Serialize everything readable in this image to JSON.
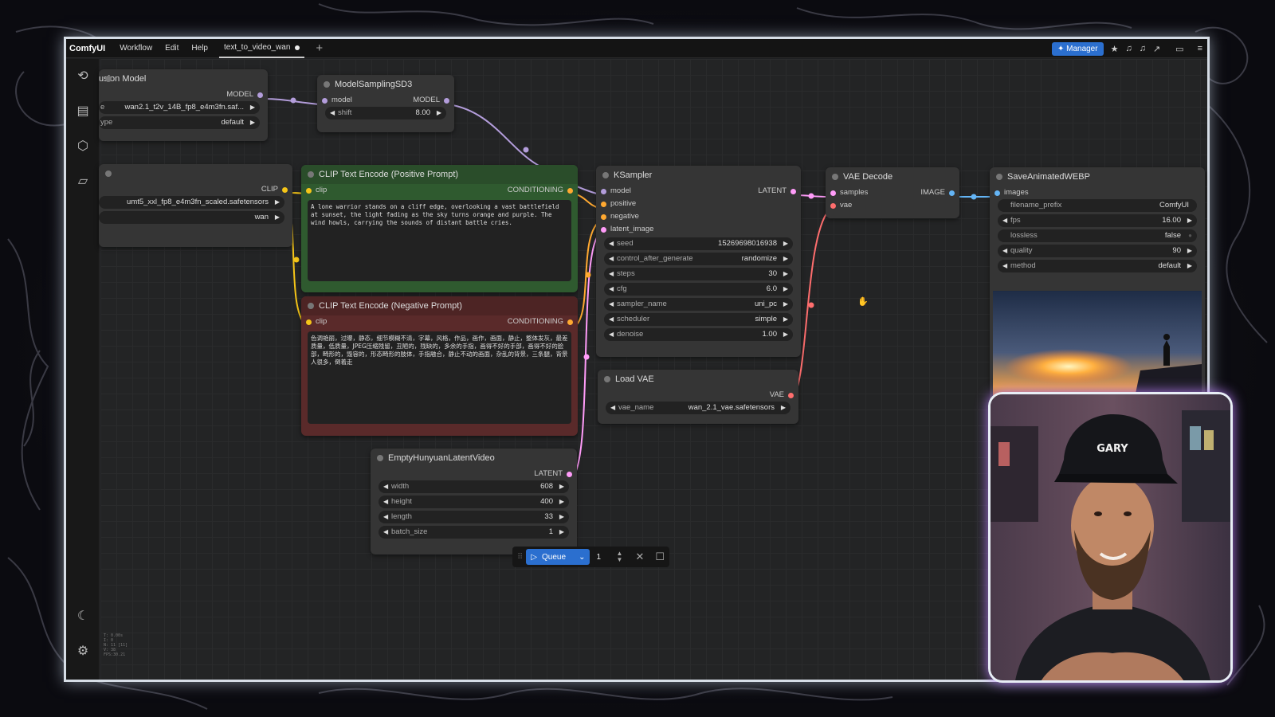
{
  "app": {
    "logo": "ComfyUI",
    "menus": [
      "Workflow",
      "Edit",
      "Help"
    ],
    "tab_name": "text_to_video_wan",
    "manager_label": "Manager"
  },
  "nodes": {
    "diffusion_model": {
      "title": "usion Model",
      "output": "MODEL",
      "widgets": [
        {
          "label": "e",
          "value": "wan2.1_t2v_14B_fp8_e4m3fn.saf..."
        },
        {
          "label": "ype",
          "value": "default"
        }
      ]
    },
    "model_sampling": {
      "title": "ModelSamplingSD3",
      "input": "model",
      "output": "MODEL",
      "widget": {
        "label": "shift",
        "value": "8.00"
      }
    },
    "clip_loader": {
      "output": "CLIP",
      "widgets": [
        {
          "label": "",
          "value": "umt5_xxl_fp8_e4m3fn_scaled.safetensors"
        },
        {
          "label": "",
          "value": "wan"
        }
      ]
    },
    "clip_positive": {
      "title": "CLIP Text Encode (Positive Prompt)",
      "input": "clip",
      "output": "CONDITIONING",
      "text": "A lone warrior stands on a cliff edge, overlooking a vast battlefield at sunset, the light fading as the sky turns orange and purple. The wind howls, carrying the sounds of distant battle cries."
    },
    "clip_negative": {
      "title": "CLIP Text Encode (Negative Prompt)",
      "input": "clip",
      "output": "CONDITIONING",
      "text": "色调艳丽，过曝，静态，细节模糊不清，字幕，风格，作品，画作，画面，静止，整体发灰，最差质量，低质量，JPEG压缩残留，丑陋的，残缺的，多余的手指，画得不好的手部，画得不好的脸部，畸形的，毁容的，形态畸形的肢体，手指融合，静止不动的画面，杂乱的背景，三条腿，背景人很多，倒着走"
    },
    "empty_latent": {
      "title": "EmptyHunyuanLatentVideo",
      "output": "LATENT",
      "widgets": [
        {
          "label": "width",
          "value": "608"
        },
        {
          "label": "height",
          "value": "400"
        },
        {
          "label": "length",
          "value": "33"
        },
        {
          "label": "batch_size",
          "value": "1"
        }
      ]
    },
    "ksampler": {
      "title": "KSampler",
      "inputs": [
        "model",
        "positive",
        "negative",
        "latent_image"
      ],
      "output": "LATENT",
      "widgets": [
        {
          "label": "seed",
          "value": "15269698016938"
        },
        {
          "label": "control_after_generate",
          "value": "randomize"
        },
        {
          "label": "steps",
          "value": "30"
        },
        {
          "label": "cfg",
          "value": "6.0"
        },
        {
          "label": "sampler_name",
          "value": "uni_pc"
        },
        {
          "label": "scheduler",
          "value": "simple"
        },
        {
          "label": "denoise",
          "value": "1.00"
        }
      ]
    },
    "load_vae": {
      "title": "Load VAE",
      "output": "VAE",
      "widget": {
        "label": "vae_name",
        "value": "wan_2.1_vae.safetensors"
      }
    },
    "vae_decode": {
      "title": "VAE Decode",
      "inputs": [
        "samples",
        "vae"
      ],
      "output": "IMAGE"
    },
    "save_webp": {
      "title": "SaveAnimatedWEBP",
      "input": "images",
      "widgets": [
        {
          "label": "filename_prefix",
          "value": "ComfyUI"
        },
        {
          "label": "fps",
          "value": "16.00"
        },
        {
          "label": "lossless",
          "value": "false"
        },
        {
          "label": "quality",
          "value": "90"
        },
        {
          "label": "method",
          "value": "default"
        }
      ]
    }
  },
  "queue": {
    "label": "Queue",
    "count": "1"
  },
  "stats": [
    "T: 0.00s",
    "I: 0",
    "N: 11 [11]",
    "V: 38",
    "FPS:30.21"
  ],
  "webcam": {
    "cap_text": "GARY"
  },
  "colors": {
    "accent": "#2b6fcf",
    "model_wire": "#b39ddb",
    "clip_wire": "#f5c518",
    "conditioning_wire": "#ffa931",
    "latent_wire": "#ff9cf9",
    "vae_wire": "#ff6e6e",
    "image_wire": "#64b5f6",
    "positive_node": "#2f5a2f",
    "negative_node": "#5a2a2a"
  }
}
